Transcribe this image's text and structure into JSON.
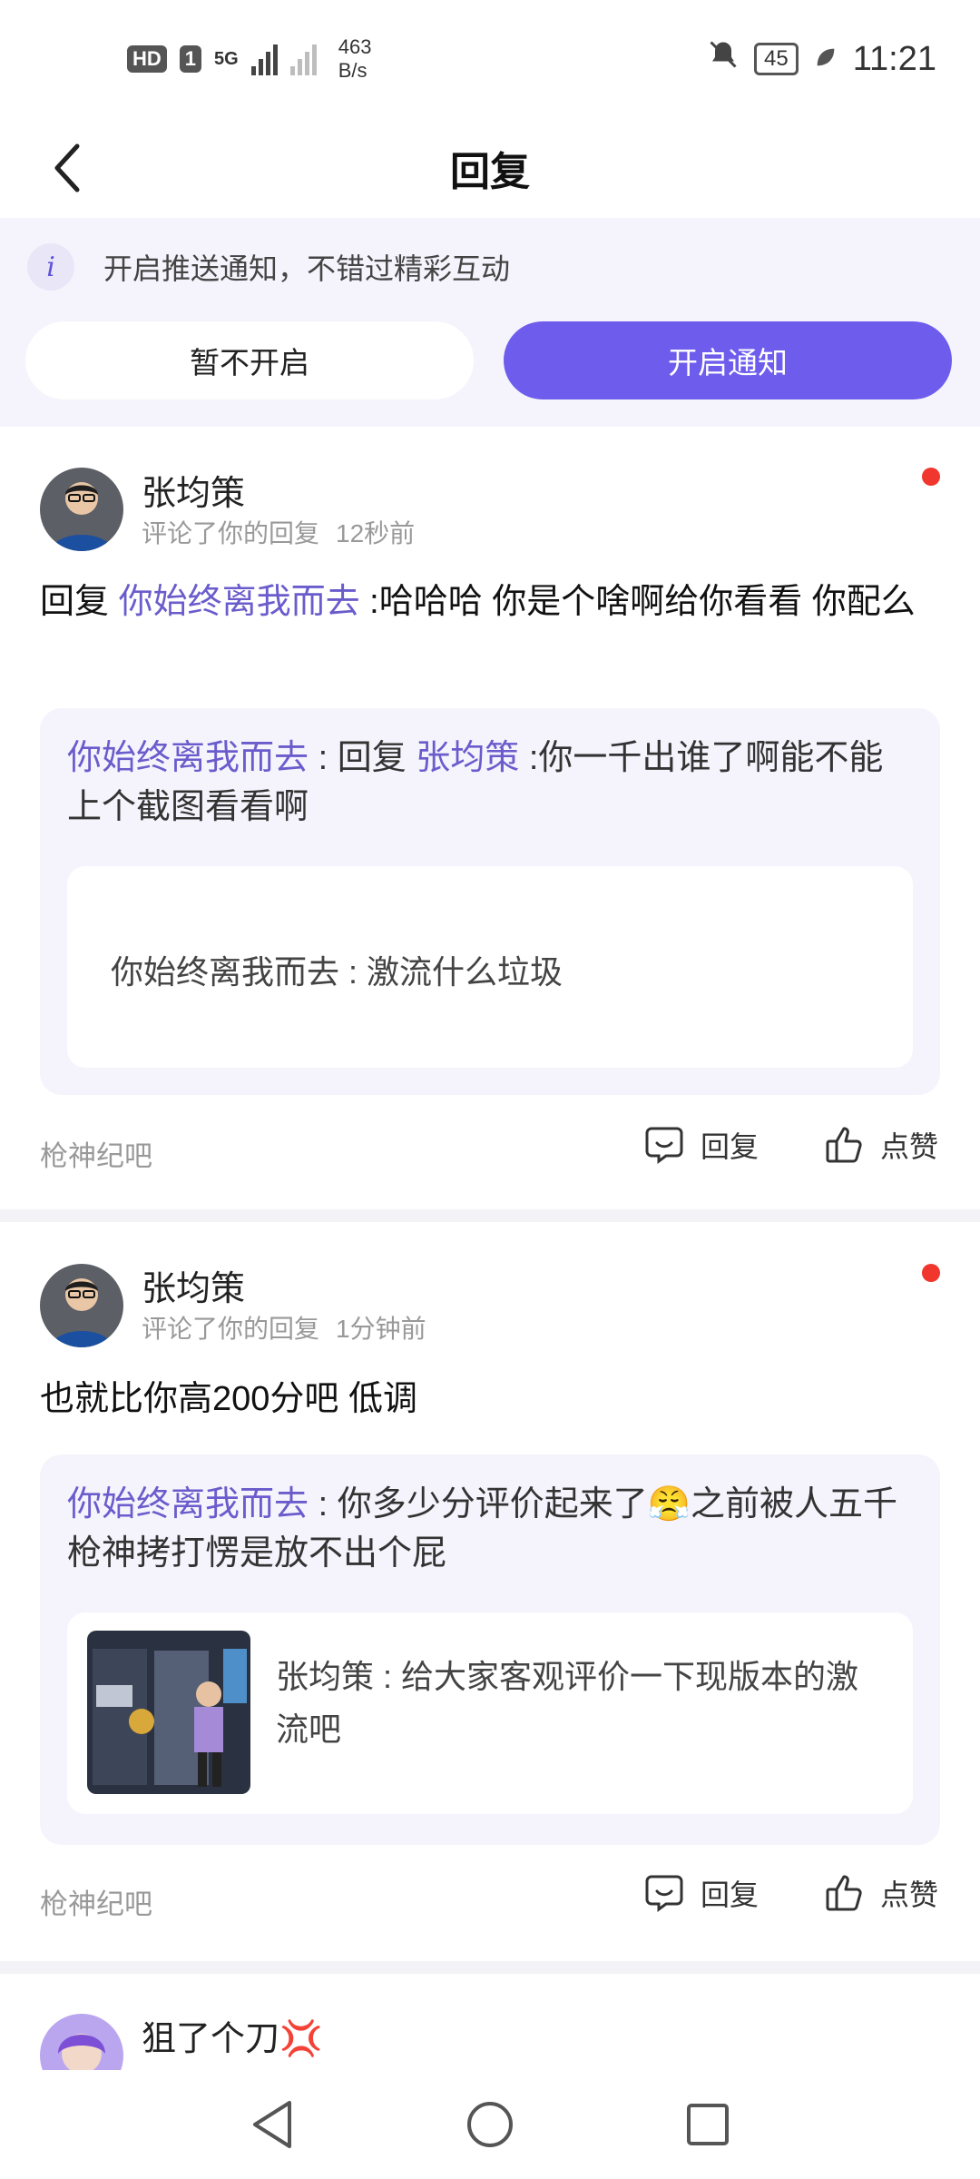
{
  "status_bar": {
    "badges": [
      "HD",
      "1"
    ],
    "network": "5G",
    "speed_value": "463",
    "speed_unit": "B/s",
    "battery": "45",
    "time": "11:21"
  },
  "header": {
    "title": "回复"
  },
  "notify": {
    "info_text": "开启推送通知，不错过精彩互动",
    "later_label": "暂不开启",
    "enable_label": "开启通知"
  },
  "replies": [
    {
      "user": "张均策",
      "action": "评论了你的回复",
      "time": "12秒前",
      "prefix": "回复 ",
      "mention": "你始终离我而去",
      "text": " :哈哈哈 你是个啥啊给你看看 你配么",
      "quote_author": "你始终离我而去",
      "quote_mid": " : 回复 ",
      "quote_mention": "张均策",
      "quote_text": " :你一千出谁了啊能不能上个截图看看啊",
      "origin_text": "你始终离我而去 : 激流什么垃圾",
      "forum": "枪神纪吧",
      "reply_label": "回复",
      "like_label": "点赞"
    },
    {
      "user": "张均策",
      "action": "评论了你的回复",
      "time": "1分钟前",
      "text": "也就比你高200分吧 低调",
      "quote_author": "你始终离我而去",
      "quote_text_a": " : 你多少分评价起来了",
      "quote_emoji": "😤",
      "quote_text_b": "之前被人五千枪神拷打愣是放不出个屁",
      "origin_text": "张均策 : 给大家客观评价一下现版本的激流吧",
      "forum": "枪神纪吧",
      "reply_label": "回复",
      "like_label": "点赞"
    },
    {
      "user": "狙了个刀",
      "user_emoji": "💢"
    }
  ],
  "colors": {
    "accent": "#6e5ced",
    "mention": "#6a5ccc",
    "banner_bg": "#f5f4fc",
    "unread_dot": "#f0362d"
  }
}
